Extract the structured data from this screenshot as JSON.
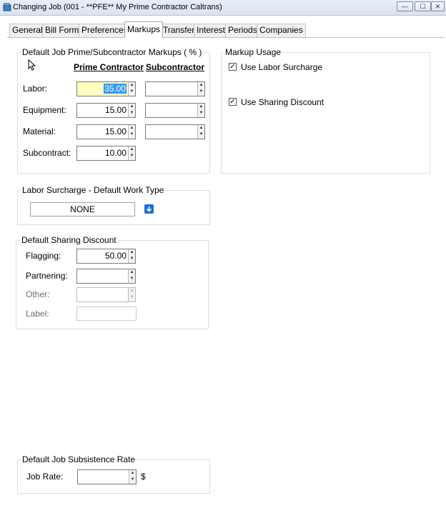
{
  "window": {
    "title": "Changing Job  (001 - **PFE** My Prime Contractor Caltrans)",
    "minimize_glyph": "—",
    "maximize_glyph": "☐",
    "close_glyph": "✕"
  },
  "tabs": [
    {
      "label": "General"
    },
    {
      "label": "Bill Form"
    },
    {
      "label": "Preferences"
    },
    {
      "label": "Markups",
      "active": true
    },
    {
      "label": "Transfer"
    },
    {
      "label": "Interest"
    },
    {
      "label": "Periods"
    },
    {
      "label": "Companies"
    }
  ],
  "markups": {
    "legend": "Default Job Prime/Subcontractor Markups ( % )",
    "col_prime": "Prime Contractor",
    "col_sub": "Subcontractor",
    "rows": [
      {
        "label": "Labor:",
        "prime": "35.00",
        "sub": ""
      },
      {
        "label": "Equipment:",
        "prime": "15.00",
        "sub": ""
      },
      {
        "label": "Material:",
        "prime": "15.00",
        "sub": ""
      },
      {
        "label": "Subcontract:",
        "prime": "10.00"
      }
    ]
  },
  "markup_usage": {
    "legend": "Markup Usage",
    "use_labor_surcharge": {
      "label": "Use Labor Surcharge",
      "checked": true
    },
    "use_sharing_discount": {
      "label": "Use Sharing Discount",
      "checked": true
    }
  },
  "labor_surcharge": {
    "legend": "Labor Surcharge - Default Work Type",
    "value": "NONE"
  },
  "sharing_discount": {
    "legend": "Default Sharing Discount",
    "flagging": {
      "label": "Flagging:",
      "value": "50.00"
    },
    "partnering": {
      "label": "Partnering:",
      "value": ""
    },
    "other": {
      "label": "Other:",
      "value": ""
    },
    "other_label": {
      "label": "Label:",
      "value": ""
    }
  },
  "subsistence": {
    "legend": "Default Job Subsistence Rate",
    "job_rate": {
      "label": "Job Rate:",
      "value": "",
      "unit": "$"
    }
  },
  "icons": {
    "app": "app-icon",
    "up": "▲",
    "down": "▼",
    "check": "✓",
    "dropdown": "arrow-down-icon"
  },
  "colors": {
    "highlight_field": "#ffffc0",
    "selection": "#3399ff",
    "dropdown_button": "#1b6ed6"
  }
}
